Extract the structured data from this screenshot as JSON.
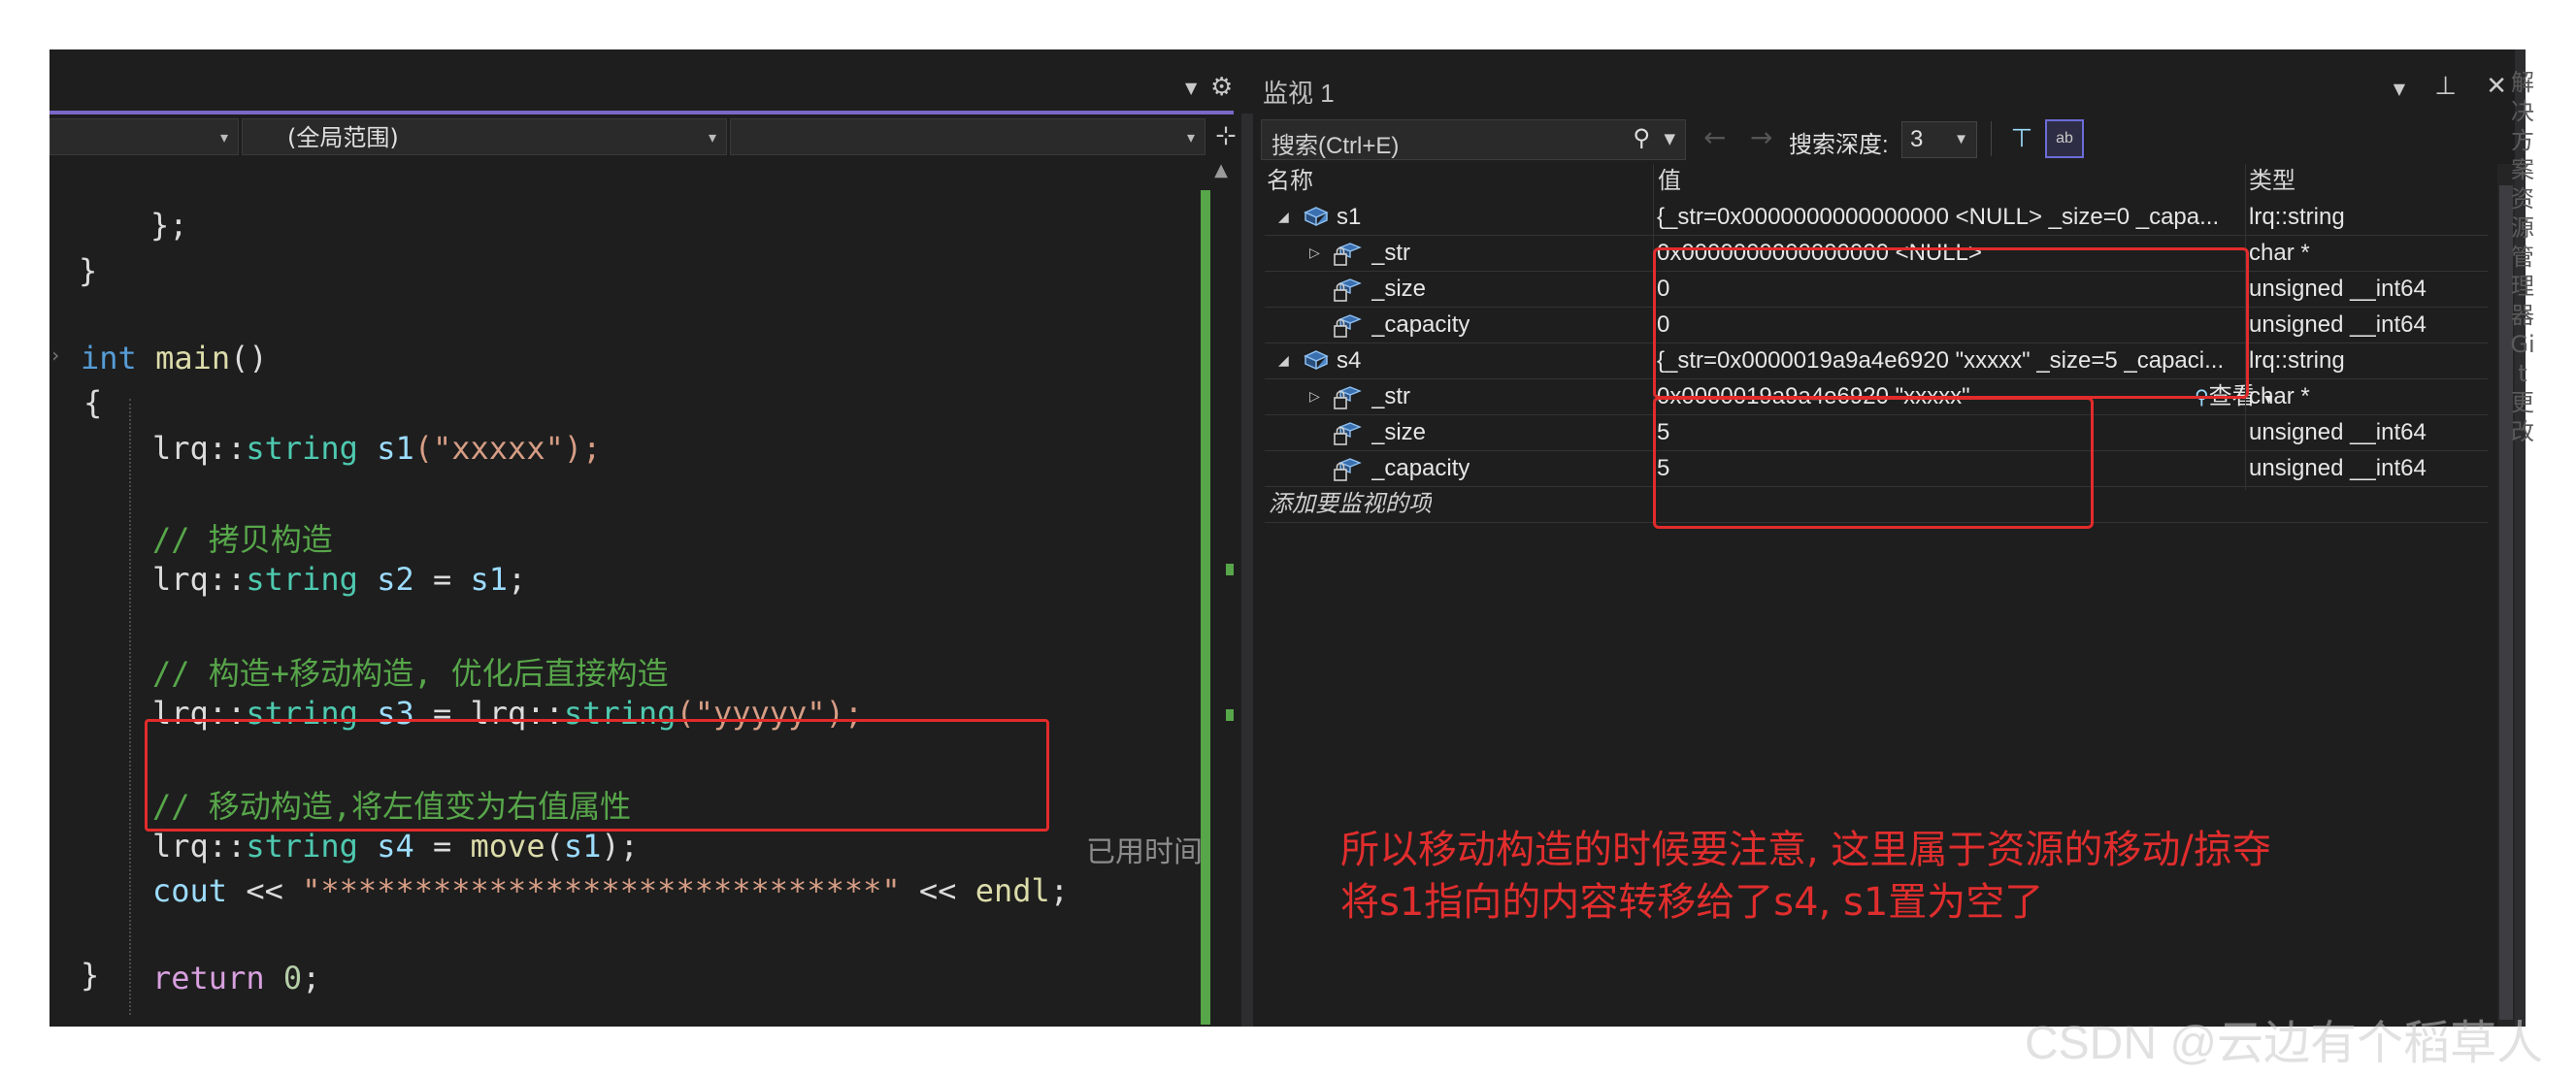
{
  "editor": {
    "scope_label": "(全局范围)",
    "elapsed_label": "已用时间",
    "code": {
      "line_close_semicolon": "};",
      "line_close_brace": "}",
      "line_int": "int",
      "line_main": "main",
      "line_main_parens": "()",
      "line_open_brace": "{",
      "s1": {
        "ns": "lrq::",
        "type": "string",
        "name": "s1",
        "args": "(\"xxxxx\");"
      },
      "comment_copy": "// 拷贝构造",
      "s2": {
        "ns": "lrq::",
        "type": "string",
        "name": "s2",
        "eq": " = ",
        "rhs": "s1",
        "end": ";"
      },
      "comment_move_ctor": "// 构造+移动构造, 优化后直接构造",
      "s3": {
        "ns": "lrq::",
        "type": "string",
        "name": "s3",
        "eq": " = ",
        "rhs_ns": "lrq::",
        "rhs_type": "string",
        "rhs_args": "(\"yyyyy\");"
      },
      "comment_move": "// 移动构造,将左值变为右值属性",
      "s4": {
        "ns": "lrq::",
        "type": "string",
        "name": "s4",
        "eq": " = ",
        "fn": "move",
        "open": "(",
        "arg": "s1",
        "close": ");"
      },
      "cout": {
        "id": "cout",
        "op1": " << ",
        "str": "\"******************************\"",
        "op2": " << ",
        "endl": "endl",
        "end": ";"
      },
      "ret": {
        "kw": "return",
        "val": "0",
        "end": ";"
      },
      "final_brace": "}"
    }
  },
  "watch": {
    "title": "监视 1",
    "search_placeholder": "搜索(Ctrl+E)",
    "depth_label": "搜索深度:",
    "depth_value": "3",
    "hex_label": "ab",
    "columns": {
      "name": "名称",
      "value": "值",
      "type": "类型"
    },
    "rows": [
      {
        "name": "s1",
        "value": "{_str=0x0000000000000000 <NULL> _size=0 _capa...",
        "type": "lrq::string"
      },
      {
        "name": "_str",
        "value": "0x0000000000000000 <NULL>",
        "type": "char *"
      },
      {
        "name": "_size",
        "value": "0",
        "type": "unsigned __int64"
      },
      {
        "name": "_capacity",
        "value": "0",
        "type": "unsigned __int64"
      },
      {
        "name": "s4",
        "value": "{_str=0x0000019a9a4e6920 \"xxxxx\" _size=5 _capaci...",
        "type": "lrq::string"
      },
      {
        "name": "_str",
        "value": "0x0000019a9a4e6920 \"xxxxx\"",
        "type": "char *"
      },
      {
        "name": "_size",
        "value": "5",
        "type": "unsigned __int64"
      },
      {
        "name": "_capacity",
        "value": "5",
        "type": "unsigned __int64"
      }
    ],
    "add_item": "添加要监视的项",
    "view_label": "查看",
    "annotation_line1": "所以移动构造的时候要注意, 这里属于资源的移动/掠夺",
    "annotation_line2": "将s1指向的内容转移给了s4, s1置为空了"
  },
  "rail_text": "解决方案资源管理器 Git 更改",
  "watermark": "CSDN @云边有个稻草人",
  "colors": {
    "accent": "#7b68c8",
    "annotation": "#e22b2b",
    "green_bar": "#57a64a"
  }
}
